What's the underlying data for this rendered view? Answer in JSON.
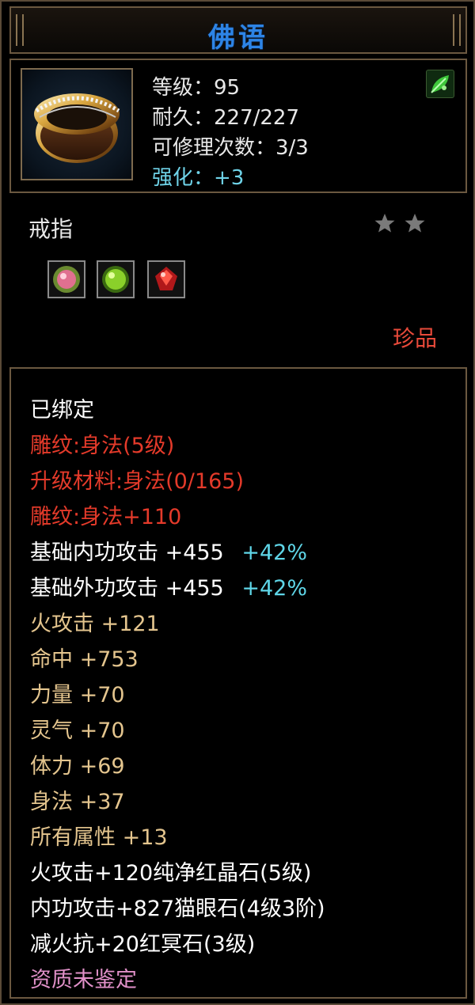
{
  "title": "佛语",
  "header": {
    "level": "等级：95",
    "durability": "耐久：227/227",
    "repair_count": "可修理次数：3/3",
    "enhance": "强化：+3",
    "item_icon": "ring-icon",
    "badge_icon": "leaf-icon"
  },
  "item_type": "戒指",
  "stars": 2,
  "gems": [
    "pink-gem-icon",
    "green-gem-icon",
    "red-gem-icon"
  ],
  "rarity": "珍品",
  "attributes": {
    "bound": "已绑定",
    "engrave": "雕纹:身法(5级)",
    "upgrade_material": "升级材料:身法(0/165)",
    "engrave_bonus": "雕纹:身法+110",
    "base_inner_attack": "基础内功攻击  +455",
    "base_inner_attack_pct": "+42%",
    "base_outer_attack": "基础外功攻击  +455",
    "base_outer_attack_pct": "+42%",
    "fire_attack": "火攻击  +121",
    "hit": "命中  +753",
    "strength": "力量  +70",
    "spirit": "灵气  +70",
    "stamina": "体力  +69",
    "agility": "身法  +37",
    "all_attributes": "所有属性  +13",
    "gem_fire": "火攻击+120纯净红晶石(5级)",
    "gem_inner": "内功攻击+827猫眼石(4级3阶)",
    "gem_fire_resist": "减火抗+20红冥石(3级)",
    "aptitude": "资质未鉴定"
  },
  "colors": {
    "title": "#2d84e6",
    "red_text": "#e43a2a",
    "tan_text": "#e4c58e",
    "cyan_text": "#5fd6e8",
    "pink_text": "#e090c8",
    "frame": "#6b5840"
  }
}
